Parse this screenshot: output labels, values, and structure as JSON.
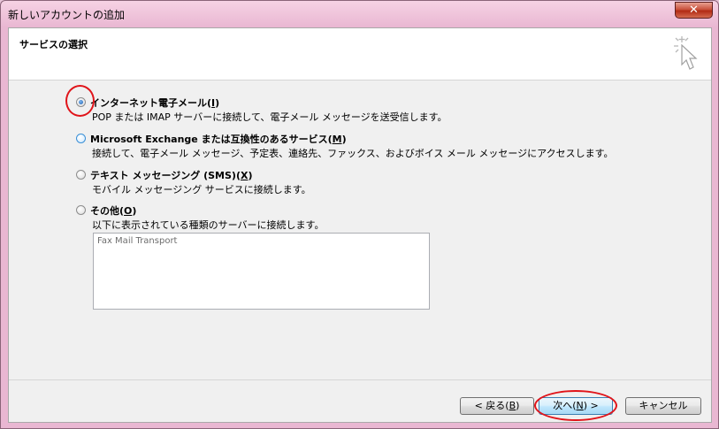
{
  "window": {
    "title": "新しいアカウントの追加",
    "close_glyph": "✕"
  },
  "header": {
    "title": "サービスの選択",
    "icon": "wizard-sparkle-cursor-icon"
  },
  "options": [
    {
      "label_pre": "インターネット電子メール(",
      "label_key": "I",
      "label_post": ")",
      "desc": "POP または IMAP サーバーに接続して、電子メール メッセージを送受信します。",
      "selected": true
    },
    {
      "label_pre": "Microsoft Exchange または互換性のあるサービス(",
      "label_key": "M",
      "label_post": ")",
      "desc": "接続して、電子メール メッセージ、予定表、連絡先、ファックス、およびボイス メール メッセージにアクセスします。",
      "selected": false
    },
    {
      "label_pre": "テキスト メッセージング (SMS)(",
      "label_key": "X",
      "label_post": ")",
      "desc": "モバイル メッセージング サービスに接続します。",
      "selected": false
    },
    {
      "label_pre": "その他(",
      "label_key": "O",
      "label_post": ")",
      "desc": "以下に表示されている種類のサーバーに接続します。",
      "selected": false
    }
  ],
  "other_list": {
    "items": [
      "Fax Mail Transport"
    ]
  },
  "buttons": {
    "back": {
      "pre": "< 戻る(",
      "key": "B",
      "post": ")"
    },
    "next": {
      "pre": "次へ(",
      "key": "N",
      "post": ") >"
    },
    "cancel": {
      "label": "キャンセル"
    }
  },
  "colors": {
    "highlight_circle": "#e0141a",
    "title_bar": "#e9b7d2"
  }
}
